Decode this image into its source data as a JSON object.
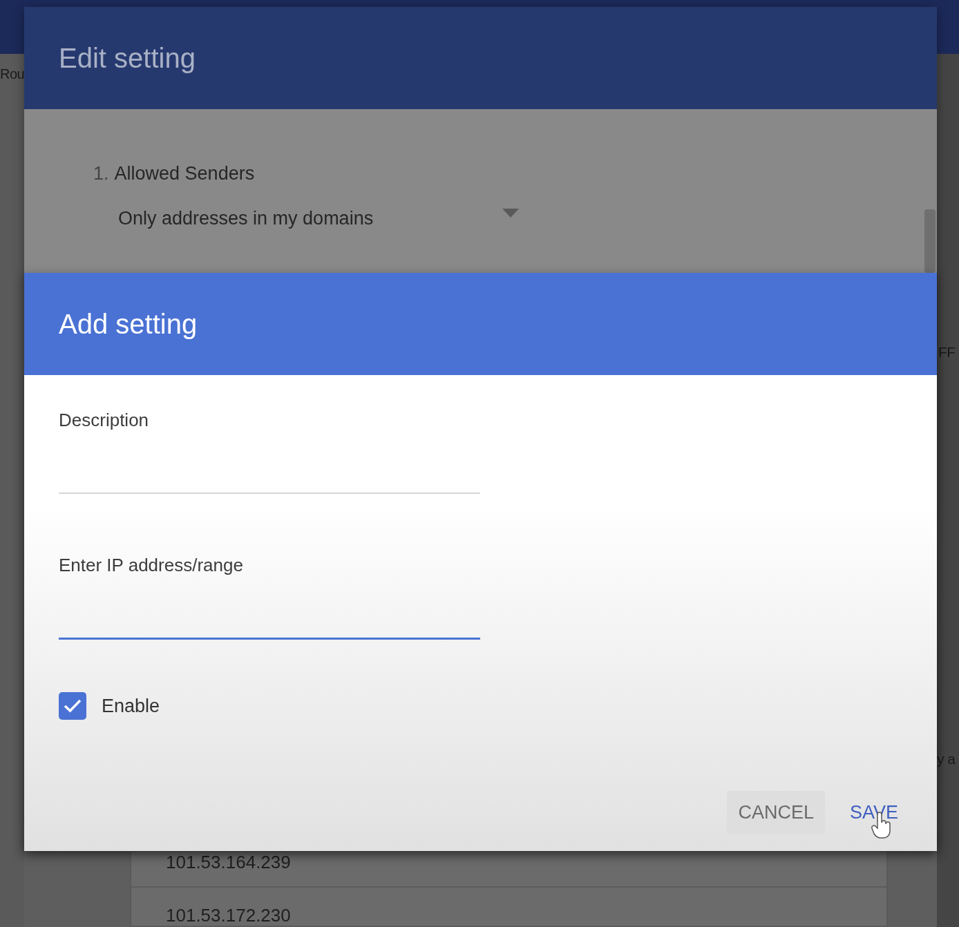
{
  "background": {
    "left_label": "Rou",
    "right_label": "FF",
    "right_text": "y a",
    "table": {
      "rows": [
        {
          "address": "101.53.164.239"
        },
        {
          "address": "101.53.172.230"
        }
      ]
    }
  },
  "edit_dialog": {
    "title": "Edit setting",
    "item_number": "1.",
    "item_label": "Allowed Senders",
    "dropdown": {
      "value": "Only addresses in my domains"
    }
  },
  "add_dialog": {
    "title": "Add setting",
    "fields": [
      {
        "label": "Description",
        "focused": false
      },
      {
        "label": "Enter IP address/range",
        "focused": true
      }
    ],
    "enable": {
      "label": "Enable",
      "checked": true
    },
    "buttons": [
      {
        "label": "CANCEL",
        "primary": false
      },
      {
        "label": "SAVE",
        "primary": true
      }
    ]
  }
}
